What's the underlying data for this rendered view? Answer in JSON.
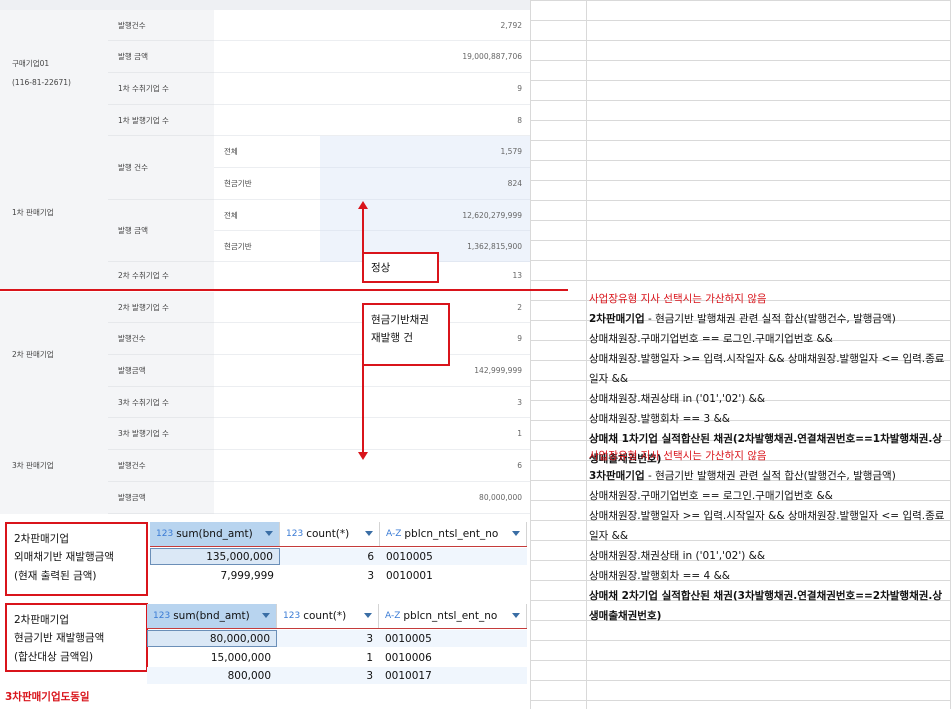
{
  "report": {
    "buyer_name": "구매기업01",
    "buyer_bizno": "(116-81-22671)",
    "buyer_rows": [
      {
        "label": "발행건수",
        "value": "2,792"
      },
      {
        "label": "발행 금액",
        "value": "19,000,887,706"
      },
      {
        "label": "1차 수취기업 수",
        "value": "9"
      }
    ],
    "first_group": "1차 판매기업",
    "first_issue_count_label": "1차 발행기업 수",
    "first_issue_count_value": "8",
    "first_cnt_label": "발행 건수",
    "first_amt_label": "발행 금액",
    "first_sub_rows": [
      {
        "label": "전체",
        "value": "1,579"
      },
      {
        "label": "현금기반",
        "value": "824"
      },
      {
        "label": "전체",
        "value": "12,620,279,999"
      },
      {
        "label": "현금기반",
        "value": "1,362,815,900"
      }
    ],
    "first_recv_label": "2차 수취기업 수",
    "first_recv_value": "13",
    "second_group": "2차 판매기업",
    "second_rows": [
      {
        "label": "2차 발행기업 수",
        "value": "2"
      },
      {
        "label": "발행건수",
        "value": "9"
      },
      {
        "label": "발행금액",
        "value": "142,999,999"
      },
      {
        "label": "3차 수취기업 수",
        "value": "3"
      }
    ],
    "third_group": "3차 판매기업",
    "third_rows": [
      {
        "label": "3차 발행기업 수",
        "value": "1"
      },
      {
        "label": "발행건수",
        "value": "6"
      },
      {
        "label": "발행금액",
        "value": "80,000,000"
      }
    ]
  },
  "notes": {
    "normal": "정상",
    "cash_reissue_line1": "현금기반채권",
    "cash_reissue_line2": "재발행 건",
    "second_box_line1": "2차판매기업",
    "second_box_line2": "외매채기반 재발행금액",
    "second_box_line3": "(현재 출력된 금액)",
    "third_box_line1": "2차판매기업",
    "third_box_line2": "현금기반 재발행금액",
    "third_box_line3": "(합산대상 금액임)",
    "footer": "3차판매기업도동일"
  },
  "right_text": {
    "b1_red": "사업장유형 지사 선택시는 가산하지 않음",
    "b1_bold": "2차판매기업",
    "b1_desc": " - 현금기반 발행채권 관련 실적 합산(발행건수, 발행금액)",
    "b1_l1": "상매채원장.구매기업번호 == 로그인.구매기업번호 &&",
    "b1_l2": "상매채원장.발행일자 >= 입력.시작일자 && 상매채원장.발행일자 <= 입력.종료일자 &&",
    "b1_l3": "상매채원장.채권상태 in ('01','02') &&",
    "b1_l4": "상매채원장.발행회차 == 3 &&",
    "b1_l5": "상매채 1차기업 실적합산된 채권(2차발행채권.연결채권번호==1차발행채권.상생매출채권번호)",
    "b2_red": "사업장유형 지사 선택시는 가산하지 않음",
    "b2_bold": "3차판매기업",
    "b2_desc": " - 현금기반 발행채권 관련 실적 합산(발행건수, 발행금액)",
    "b2_l1": "상매채원장.구매기업번호 == 로그인.구매기업번호 &&",
    "b2_l2": "상매채원장.발행일자 >= 입력.시작일자 && 상매채원장.발행일자 <= 입력.종료일자 &&",
    "b2_l3": "상매채원장.채권상태 in ('01','02') &&",
    "b2_l4": "상매채원장.발행회차 == 4 &&",
    "b2_l5": "상매채 2차기업 실적합산된 채권(3차발행채권.연결채권번호==2차발행채권.상생매출채권번호)"
  },
  "grid1": {
    "columns": [
      {
        "type": "123",
        "name": "sum(bnd_amt)"
      },
      {
        "type": "123",
        "name": "count(*)"
      },
      {
        "type": "A-Z",
        "name": "pblcn_ntsl_ent_no"
      }
    ],
    "rows": [
      [
        "135,000,000",
        "6",
        "0010005"
      ],
      [
        "7,999,999",
        "3",
        "0010001"
      ]
    ]
  },
  "grid2": {
    "columns": [
      {
        "type": "123",
        "name": "sum(bnd_amt)"
      },
      {
        "type": "123",
        "name": "count(*)"
      },
      {
        "type": "A-Z",
        "name": "pblcn_ntsl_ent_no"
      }
    ],
    "rows": [
      [
        "80,000,000",
        "3",
        "0010005"
      ],
      [
        "15,000,000",
        "1",
        "0010006"
      ],
      [
        "800,000",
        "3",
        "0010017"
      ]
    ]
  },
  "colors": {
    "accent_red": "#d9141b",
    "grid_select": "#b8d4ef"
  }
}
